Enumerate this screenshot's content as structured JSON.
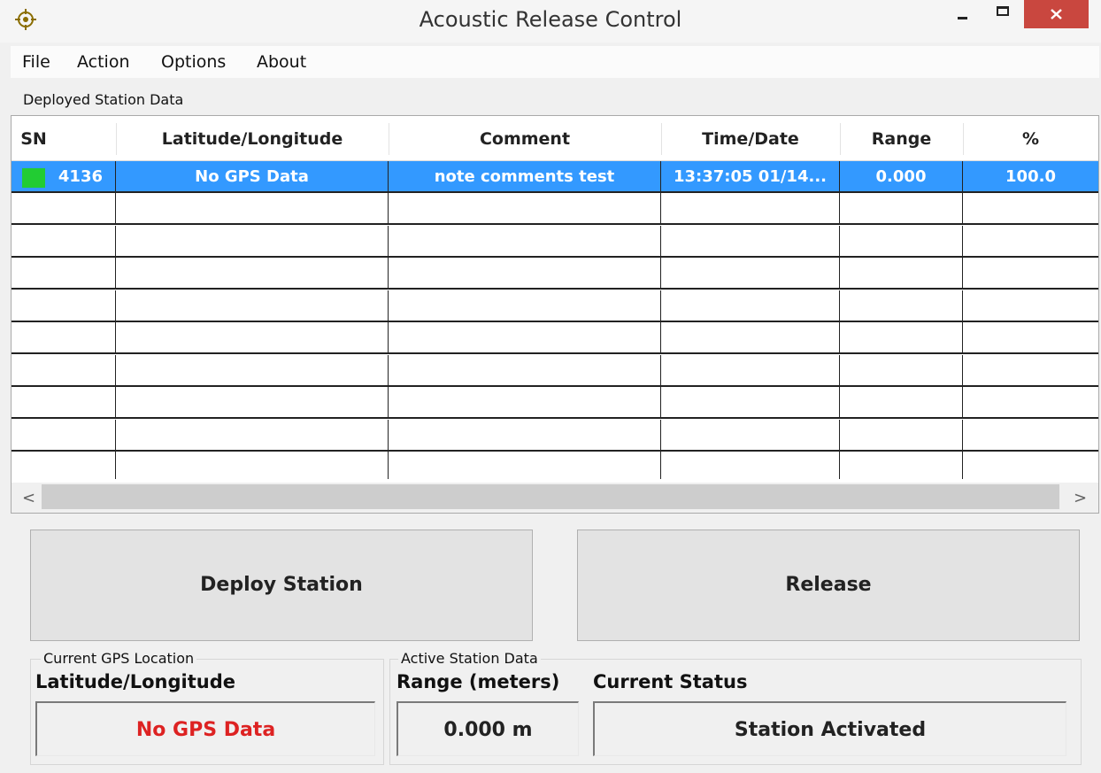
{
  "window": {
    "title": "Acoustic Release Control",
    "icons": {
      "app": "crosshair-target-icon",
      "minimize": "minimize-icon",
      "maximize": "maximize-icon",
      "close": "close-icon"
    },
    "colors": {
      "close_button": "#c9473f",
      "app_icon": "#8a6d00"
    }
  },
  "menu": {
    "items": [
      {
        "label": "File"
      },
      {
        "label": "Action"
      },
      {
        "label": "Options"
      },
      {
        "label": "About"
      }
    ]
  },
  "deployed": {
    "label": "Deployed Station Data",
    "columns": [
      "SN",
      "Latitude/Longitude",
      "Comment",
      "Time/Date",
      "Range",
      "%"
    ],
    "rows": [
      {
        "sn": "4136",
        "latlon": "No GPS Data",
        "comment": "note comments test",
        "time": "13:37:05 01/14...",
        "range": "0.000",
        "percent": "100.0",
        "status_color": "#22cc33",
        "selected": true
      }
    ],
    "empty_rows": 9,
    "colors": {
      "selection": "#3399ff"
    },
    "scroll": {
      "left_arrow": "<",
      "right_arrow": ">"
    }
  },
  "actions": {
    "deploy_label": "Deploy Station",
    "release_label": "Release"
  },
  "gps": {
    "group_title": "Current GPS Location",
    "label": "Latitude/Longitude",
    "value": "No GPS Data",
    "value_color": "#dd2222"
  },
  "active": {
    "group_title": "Active Station Data",
    "range_label": "Range (meters)",
    "range_value": "0.000 m",
    "status_label": "Current Status",
    "status_value": "Station Activated"
  }
}
